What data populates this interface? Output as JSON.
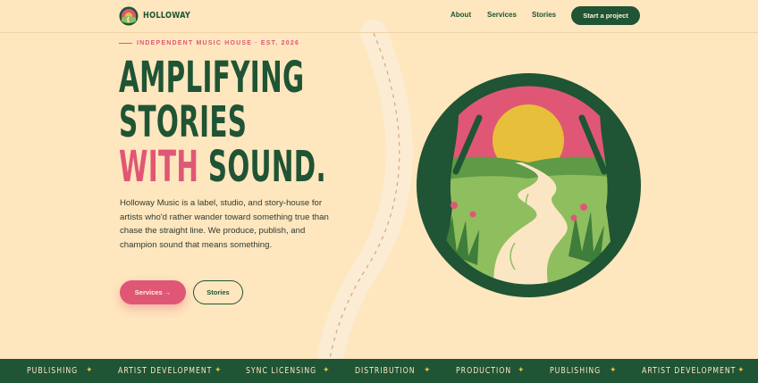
{
  "colors": {
    "cream": "#fee6be",
    "forest": "#1f5434",
    "rose": "#e05775",
    "sun": "#e8bf3b",
    "meadow": "#8fbe5e"
  },
  "nav": {
    "brand": "HOLLOWAY",
    "links": [
      "About",
      "Services",
      "Stories"
    ],
    "cta": "Start a project",
    "logo_icon": "sunset-emblem-icon"
  },
  "hero": {
    "eyebrow": "INDEPENDENT MUSIC HOUSE · EST. 2026",
    "headline_line1": "AMPLIFYING",
    "headline_line2": "STORIES",
    "headline_accent": "WITH",
    "headline_end": " SOUND.",
    "lede": "Holloway Music is a label, studio, and story-house for artists who'd rather wander toward something true than chase the straight line. We produce, publish, and champion sound that means something.",
    "primary_button": "Services →",
    "secondary_button": "Stories",
    "emblem_icon": "forest-sunset-path-icon"
  },
  "marquee": {
    "items": [
      "PUBLISHING",
      "ARTIST DEVELOPMENT",
      "SYNC LICENSING",
      "DISTRIBUTION",
      "PRODUCTION",
      "PUBLISHING",
      "ARTIST DEVELOPMENT"
    ],
    "separator": "✦"
  }
}
